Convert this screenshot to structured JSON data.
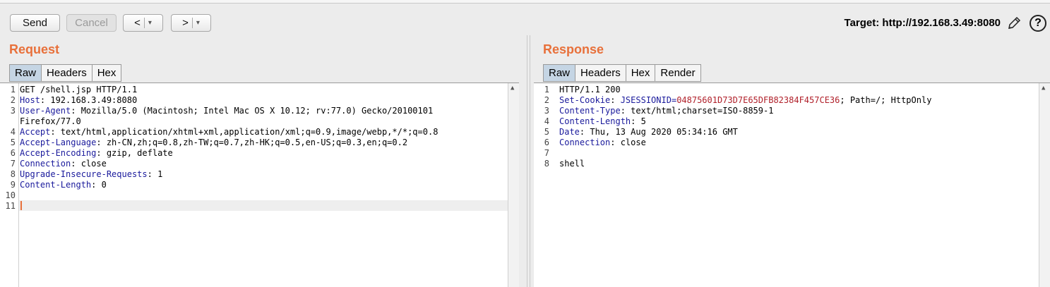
{
  "toolbar": {
    "send_label": "Send",
    "cancel_label": "Cancel",
    "back_label": "<",
    "forward_label": ">",
    "dropdown_glyph": "▾",
    "target_text": "Target: http://192.168.3.49:8080",
    "help_glyph": "?"
  },
  "request": {
    "title": "Request",
    "tabs": [
      "Raw",
      "Headers",
      "Hex"
    ],
    "active_tab": "Raw",
    "lines": [
      {
        "n": "1",
        "key": "",
        "val": "GET /shell.jsp HTTP/1.1"
      },
      {
        "n": "2",
        "key": "Host",
        "val": ": 192.168.3.49:8080"
      },
      {
        "n": "3",
        "key": "User-Agent",
        "val": ": Mozilla/5.0 (Macintosh; Intel Mac OS X 10.12; rv:77.0) Gecko/20100101"
      },
      {
        "n": "",
        "key": "",
        "val": "Firefox/77.0"
      },
      {
        "n": "4",
        "key": "Accept",
        "val": ": text/html,application/xhtml+xml,application/xml;q=0.9,image/webp,*/*;q=0.8"
      },
      {
        "n": "5",
        "key": "Accept-Language",
        "val": ": zh-CN,zh;q=0.8,zh-TW;q=0.7,zh-HK;q=0.5,en-US;q=0.3,en;q=0.2"
      },
      {
        "n": "6",
        "key": "Accept-Encoding",
        "val": ": gzip, deflate"
      },
      {
        "n": "7",
        "key": "Connection",
        "val": ": close"
      },
      {
        "n": "8",
        "key": "Upgrade-Insecure-Requests",
        "val": ": 1"
      },
      {
        "n": "9",
        "key": "Content-Length",
        "val": ": 0"
      },
      {
        "n": "10",
        "key": "",
        "val": ""
      },
      {
        "n": "11",
        "key": "",
        "val": ""
      }
    ]
  },
  "response": {
    "title": "Response",
    "tabs": [
      "Raw",
      "Headers",
      "Hex",
      "Render"
    ],
    "active_tab": "Raw",
    "lines": [
      {
        "n": "1",
        "key": "",
        "val": "HTTP/1.1 200"
      },
      {
        "n": "2",
        "key": "Set-Cookie",
        "val": ": ",
        "cookie_name": "JSESSIONID=",
        "cookie_val": "04875601D73D7E65DFB82384F457CE36",
        "rest": "; Path=/; HttpOnly"
      },
      {
        "n": "3",
        "key": "Content-Type",
        "val": ": text/html;charset=ISO-8859-1"
      },
      {
        "n": "4",
        "key": "Content-Length",
        "val": ": 5"
      },
      {
        "n": "5",
        "key": "Date",
        "val": ": Thu, 13 Aug 2020 05:34:16 GMT"
      },
      {
        "n": "6",
        "key": "Connection",
        "val": ": close"
      },
      {
        "n": "7",
        "key": "",
        "val": ""
      },
      {
        "n": "8",
        "key": "",
        "val": "shell"
      }
    ]
  },
  "colors": {
    "accent": "#e8703a",
    "header_key": "#1a1a9c",
    "cookie_value": "#b0202a",
    "active_tab": "#c5d5e4"
  }
}
